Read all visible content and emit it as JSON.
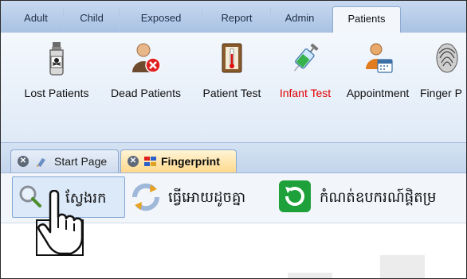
{
  "ribbon_tabs": [
    {
      "label": "Adult"
    },
    {
      "label": "Child"
    },
    {
      "label": "Exposed"
    },
    {
      "label": "Report"
    },
    {
      "label": "Admin"
    },
    {
      "label": "Patients",
      "active": true
    }
  ],
  "ribbon_buttons": [
    {
      "label": "Lost Patients",
      "icon": "poison-bottle-icon"
    },
    {
      "label": "Dead Patients",
      "icon": "user-remove-icon"
    },
    {
      "label": "Patient Test",
      "icon": "thermometer-icon"
    },
    {
      "label": "Infant Test",
      "icon": "syringe-icon",
      "color": "#e00000"
    },
    {
      "label": "Appointment",
      "icon": "user-calendar-icon"
    },
    {
      "label": "Finger P",
      "icon": "fingerprint-icon"
    }
  ],
  "doc_tabs": [
    {
      "label": "Start Page",
      "active": false
    },
    {
      "label": "Fingerprint",
      "active": true
    }
  ],
  "toolbar": {
    "search_label": "ស្វែងរក",
    "redo_label": "ធ្វើអោយដូចគ្នា",
    "refresh_label": "កំណត់ឧបករណ៍ផ្តិតម្រ"
  },
  "colors": {
    "accent": "#1ea03a",
    "active_tab": "#ffd98c",
    "ribbon_bg": "#dfeaf7",
    "alert_text": "#e00000"
  }
}
